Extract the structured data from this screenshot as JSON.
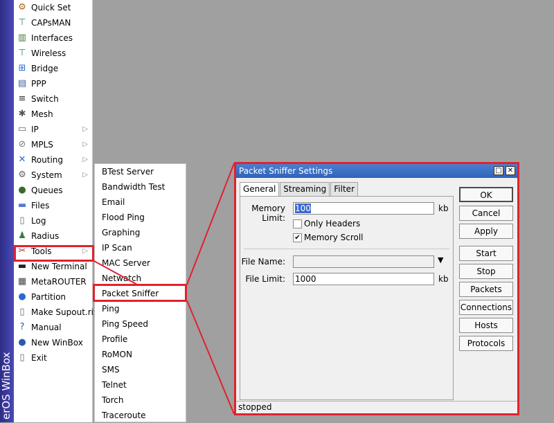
{
  "brand": {
    "text": "erOS WinBox"
  },
  "main_menu": [
    {
      "label": "Quick Set",
      "icon": "quick-set-icon",
      "glyph": "⚙",
      "color": "#a66a1e"
    },
    {
      "label": "CAPsMAN",
      "icon": "capsman-icon",
      "glyph": "⊤",
      "color": "#2a8a4a"
    },
    {
      "label": "Interfaces",
      "icon": "interfaces-icon",
      "glyph": "▥",
      "color": "#4a7a3a"
    },
    {
      "label": "Wireless",
      "icon": "wireless-icon",
      "glyph": "⊤",
      "color": "#2a8a4a"
    },
    {
      "label": "Bridge",
      "icon": "bridge-icon",
      "glyph": "⊞",
      "color": "#2a6ad0"
    },
    {
      "label": "PPP",
      "icon": "ppp-icon",
      "glyph": "▤",
      "color": "#4060a0"
    },
    {
      "label": "Switch",
      "icon": "switch-icon",
      "glyph": "≡",
      "color": "#333"
    },
    {
      "label": "Mesh",
      "icon": "mesh-icon",
      "glyph": "✱",
      "color": "#555"
    },
    {
      "label": "IP",
      "icon": "ip-icon",
      "glyph": "▭",
      "color": "#666",
      "arrow": "▷"
    },
    {
      "label": "MPLS",
      "icon": "mpls-icon",
      "glyph": "⊘",
      "color": "#777",
      "arrow": "▷"
    },
    {
      "label": "Routing",
      "icon": "routing-icon",
      "glyph": "✕",
      "color": "#2a6ad0",
      "arrow": "▷"
    },
    {
      "label": "System",
      "icon": "system-icon",
      "glyph": "⚙",
      "color": "#666",
      "arrow": "▷"
    },
    {
      "label": "Queues",
      "icon": "queues-icon",
      "glyph": "●",
      "color": "#3a6a2a"
    },
    {
      "label": "Files",
      "icon": "files-icon",
      "glyph": "▬",
      "color": "#5a7ad0"
    },
    {
      "label": "Log",
      "icon": "log-icon",
      "glyph": "▯",
      "color": "#666"
    },
    {
      "label": "Radius",
      "icon": "radius-icon",
      "glyph": "♟",
      "color": "#3a7a3a"
    },
    {
      "label": "Tools",
      "icon": "tools-icon",
      "glyph": "✂",
      "color": "#b03020",
      "arrow": "▷"
    },
    {
      "label": "New Terminal",
      "icon": "terminal-icon",
      "glyph": "▬",
      "color": "#222"
    },
    {
      "label": "MetaROUTER",
      "icon": "metarouter-icon",
      "glyph": "▦",
      "color": "#444"
    },
    {
      "label": "Partition",
      "icon": "partition-icon",
      "glyph": "●",
      "color": "#2a6ad0"
    },
    {
      "label": "Make Supout.rif",
      "icon": "supout-icon",
      "glyph": "▯",
      "color": "#666"
    },
    {
      "label": "Manual",
      "icon": "manual-icon",
      "glyph": "?",
      "color": "#2a5ab0"
    },
    {
      "label": "New WinBox",
      "icon": "winbox-icon",
      "glyph": "●",
      "color": "#2a5ab0"
    },
    {
      "label": "Exit",
      "icon": "exit-icon",
      "glyph": "▯",
      "color": "#666"
    }
  ],
  "tools_submenu": [
    "BTest Server",
    "Bandwidth Test",
    "Email",
    "Flood Ping",
    "Graphing",
    "IP Scan",
    "MAC Server",
    "Netwatch",
    "Packet Sniffer",
    "Ping",
    "Ping Speed",
    "Profile",
    "RoMON",
    "SMS",
    "Telnet",
    "Torch",
    "Traceroute"
  ],
  "dialog": {
    "title": "Packet Sniffer Settings",
    "maximize_glyph": "□",
    "close_glyph": "✕",
    "tabs": [
      "General",
      "Streaming",
      "Filter"
    ],
    "memory_limit_label": "Memory Limit:",
    "memory_limit_value": "100",
    "memory_limit_unit": "kb",
    "only_headers_label": "Only Headers",
    "only_headers_checked": "",
    "memory_scroll_label": "Memory Scroll",
    "memory_scroll_checked": "✔",
    "file_name_label": "File Name:",
    "file_name_value": "",
    "file_limit_label": "File Limit:",
    "file_limit_value": "1000",
    "file_limit_unit": "kb",
    "dropdown_glyph": "▼",
    "buttons": [
      "OK",
      "Cancel",
      "Apply",
      "Start",
      "Stop",
      "Packets",
      "Connections",
      "Hosts",
      "Protocols"
    ],
    "status": "stopped"
  },
  "colors": {
    "highlight": "#e0222e",
    "title_bar": "#2f63b8"
  }
}
